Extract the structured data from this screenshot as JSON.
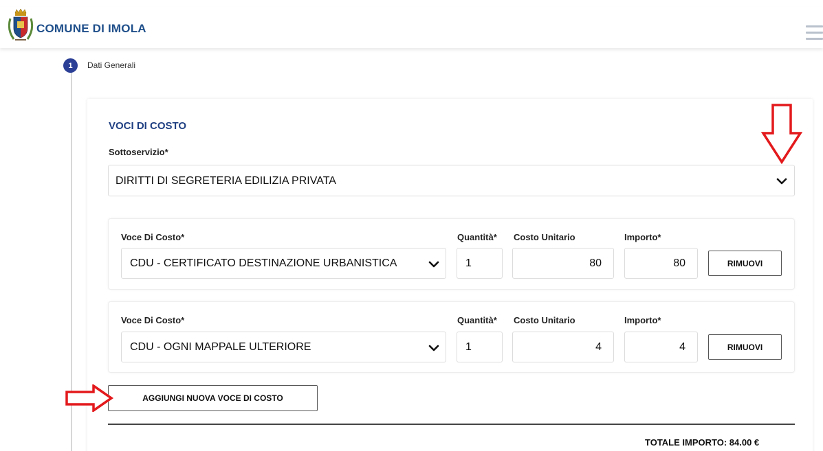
{
  "header": {
    "brand": "COMUNE DI IMOLA",
    "logo_icon": "city-crest-icon",
    "menu_icon": "hamburger-menu-icon"
  },
  "stepper": {
    "step_number": "1",
    "step_label": "Dati Generali"
  },
  "section": {
    "title": "VOCI DI COSTO",
    "sottoservizio_label": "Sottoservizio*",
    "sottoservizio_value": "DIRITTI DI SEGRETERIA EDILIZIA PRIVATA"
  },
  "rows": [
    {
      "voce_label": "Voce Di Costo*",
      "voce_value": "CDU - CERTIFICATO DESTINAZIONE URBANISTICA",
      "quantita_label": "Quantità*",
      "quantita_value": "1",
      "costo_label": "Costo Unitario",
      "costo_value": "80",
      "importo_label": "Importo*",
      "importo_value": "80",
      "remove_label": "RIMUOVI"
    },
    {
      "voce_label": "Voce Di Costo*",
      "voce_value": "CDU - OGNI MAPPALE ULTERIORE",
      "quantita_label": "Quantità*",
      "quantita_value": "1",
      "costo_label": "Costo Unitario",
      "costo_value": "4",
      "importo_label": "Importo*",
      "importo_value": "4",
      "remove_label": "RIMUOVI"
    }
  ],
  "actions": {
    "add_label": "AGGIUNGI NUOVA VOCE DI COSTO"
  },
  "summary": {
    "total": "TOTALE IMPORTO: 84.00 €"
  },
  "annotations": {
    "arrow_color": "#e3191c",
    "arrow_icons": [
      "down-arrow-annotation-icon",
      "right-arrow-annotation-icon"
    ]
  },
  "colors": {
    "brand_blue": "#1f4f8a",
    "step_blue": "#2b3f96"
  }
}
